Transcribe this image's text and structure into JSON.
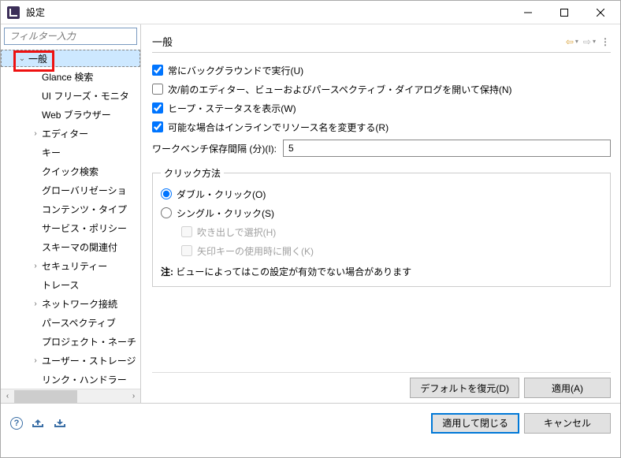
{
  "window": {
    "title": "設定"
  },
  "sidebar": {
    "filter_placeholder": "フィルター入力",
    "items": [
      {
        "label": "一般",
        "expander": "⌄",
        "indent": 1,
        "selected": true
      },
      {
        "label": "Glance 検索",
        "indent": 2
      },
      {
        "label": "UI フリーズ・モニタ",
        "indent": 2
      },
      {
        "label": "Web ブラウザー",
        "indent": 2
      },
      {
        "label": "エディター",
        "expander": "›",
        "indent": 2
      },
      {
        "label": "キー",
        "indent": 2
      },
      {
        "label": "クイック検索",
        "indent": 2
      },
      {
        "label": "グローバリゼーショ",
        "indent": 2
      },
      {
        "label": "コンテンツ・タイプ",
        "indent": 2
      },
      {
        "label": "サービス・ポリシー",
        "indent": 2
      },
      {
        "label": "スキーマの関連付",
        "indent": 2
      },
      {
        "label": "セキュリティー",
        "expander": "›",
        "indent": 2
      },
      {
        "label": "トレース",
        "indent": 2
      },
      {
        "label": "ネットワーク接続",
        "expander": "›",
        "indent": 2
      },
      {
        "label": "パースペクティブ",
        "indent": 2
      },
      {
        "label": "プロジェクト・ネーチ",
        "indent": 2
      },
      {
        "label": "ユーザー・ストレージ",
        "expander": "›",
        "indent": 2
      },
      {
        "label": "リンク・ハンドラー",
        "indent": 2
      }
    ]
  },
  "content": {
    "title": "一般",
    "chk_background": "常にバックグラウンドで実行(U)",
    "chk_reopen": "次/前のエディター、ビューおよびパースペクティブ・ダイアログを開いて保持(N)",
    "chk_heap": "ヒープ・ステータスを表示(W)",
    "chk_inline": "可能な場合はインラインでリソース名を変更する(R)",
    "interval_label": "ワークベンチ保存間隔 (分)(I):",
    "interval_value": "5",
    "click_group": "クリック方法",
    "radio_double": "ダブル・クリック(O)",
    "radio_single": "シングル・クリック(S)",
    "chk_hover": "吹き出しで選択(H)",
    "chk_arrow": "矢印キーの使用時に開く(K)",
    "note_bold": "注:",
    "note_text": " ビューによってはこの設定が有効でない場合があります",
    "btn_restore": "デフォルトを復元(D)",
    "btn_apply": "適用(A)"
  },
  "footer": {
    "btn_apply_close": "適用して閉じる",
    "btn_cancel": "キャンセル"
  }
}
